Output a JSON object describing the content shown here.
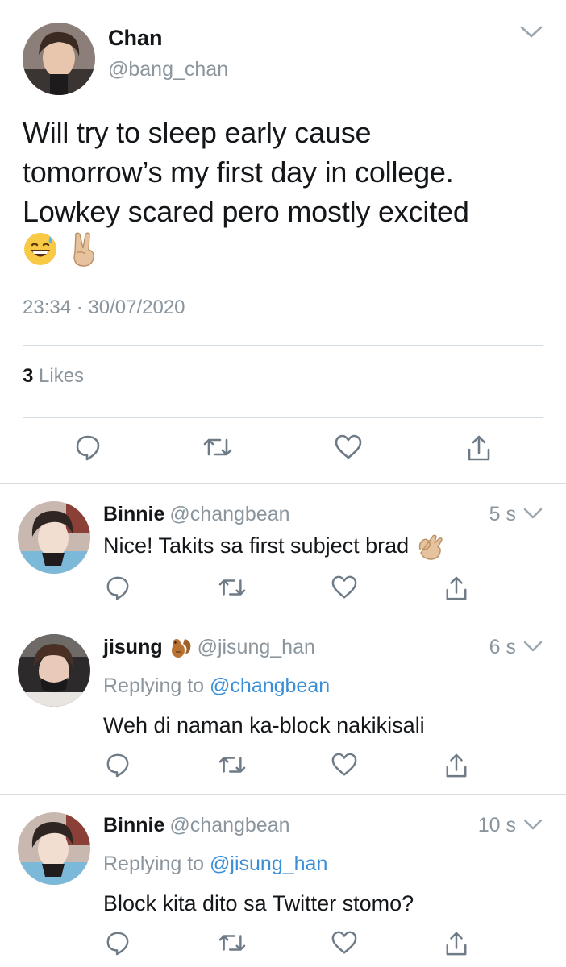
{
  "main_tweet": {
    "author_name": "Chan",
    "author_handle": "@bang_chan",
    "text_lines": [
      "Will try to sleep early cause",
      "tomorrow’s my first day in college.",
      "Lowkey scared pero mostly excited"
    ],
    "emojis": [
      "sweat-smile-emoji",
      "victory-hand-emoji"
    ],
    "time": "23:34",
    "date": "30/07/2020",
    "likes_count": "3",
    "likes_label": "Likes"
  },
  "replies": [
    {
      "name": "Binnie",
      "handle": "@changbean",
      "time": "5 s",
      "replying_prefix": "",
      "replying_to": "",
      "text": "Nice! Takits sa first subject brad",
      "emoji": "ok-hand-emoji"
    },
    {
      "name": "jisung",
      "name_emoji": "chipmunk-emoji",
      "handle": "@jisung_han",
      "time": "6 s",
      "replying_prefix": "Replying to",
      "replying_to": "@changbean",
      "text": "Weh di naman ka-block nakikisali"
    },
    {
      "name": "Binnie",
      "handle": "@changbean",
      "time": "10 s",
      "replying_prefix": "Replying to",
      "replying_to": "@jisung_han",
      "text": "Block kita dito sa Twitter stomo?"
    }
  ],
  "icons": [
    "reply-icon",
    "retweet-icon",
    "like-icon",
    "share-icon",
    "chevron-down-icon"
  ],
  "colors": {
    "text": "#14171a",
    "muted": "#8a959e",
    "link": "#3a8fd8",
    "divider": "#d6dde2",
    "icon": "#6e7b86"
  }
}
